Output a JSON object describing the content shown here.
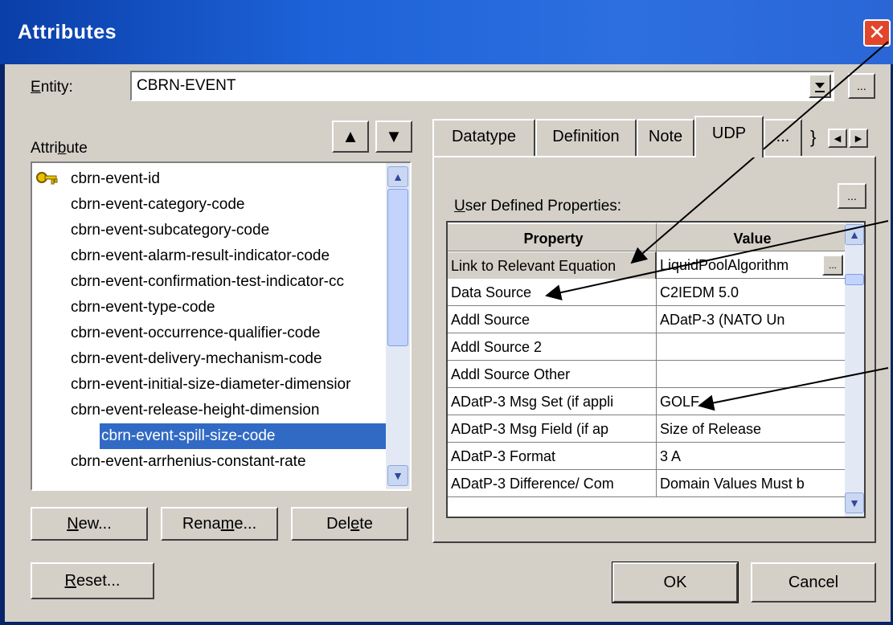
{
  "window": {
    "title": "Attributes",
    "close_glyph": "✕"
  },
  "entity": {
    "label_prefix": "E",
    "label_rest": "ntity:",
    "value": "CBRN-EVENT",
    "more_label": "..."
  },
  "attribute": {
    "label_prefix": "Attri",
    "label_u": "b",
    "label_rest": "ute",
    "up_glyph": "▲",
    "down_glyph": "▼",
    "items": [
      "cbrn-event-id",
      "cbrn-event-category-code",
      "cbrn-event-subcategory-code",
      "cbrn-event-alarm-result-indicator-code",
      "cbrn-event-confirmation-test-indicator-cc",
      "cbrn-event-type-code",
      "cbrn-event-occurrence-qualifier-code",
      "cbrn-event-delivery-mechanism-code",
      "cbrn-event-initial-size-diameter-dimensior",
      "cbrn-event-release-height-dimension",
      "cbrn-event-spill-size-code",
      "cbrn-event-arrhenius-constant-rate"
    ],
    "selected_index": 10
  },
  "tabs": [
    "Datatype",
    "Definition",
    "Note",
    "UDP",
    "...",
    "}"
  ],
  "udp": {
    "label_u": "U",
    "label_rest": "ser Defined Properties:",
    "more_label": "...",
    "headers": {
      "property": "Property",
      "value": "Value"
    },
    "rows": [
      {
        "property": "Link to Relevant Equation",
        "value": "LiquidPoolAlgorithm"
      },
      {
        "property": "Data Source",
        "value": "C2IEDM 5.0"
      },
      {
        "property": "Addl Source",
        "value": "ADatP-3 (NATO Un"
      },
      {
        "property": "Addl Source 2",
        "value": ""
      },
      {
        "property": "Addl Source Other",
        "value": ""
      },
      {
        "property": "ADatP-3 Msg Set (if appli",
        "value": "GOLF"
      },
      {
        "property": "ADatP-3 Msg Field (if ap",
        "value": "Size of Release"
      },
      {
        "property": "ADatP-3 Format",
        "value": "3 A"
      },
      {
        "property": "ADatP-3 Difference/ Com",
        "value": "Domain Values Must b"
      }
    ]
  },
  "buttons": {
    "new_u": "N",
    "new_rest": "ew...",
    "rename_pre": "Rena",
    "rename_u": "m",
    "rename_rest": "e...",
    "delete_pre": "Del",
    "delete_u": "e",
    "delete_rest": "te",
    "reset_u": "R",
    "reset_rest": "eset...",
    "ok": "OK",
    "cancel": "Cancel"
  }
}
